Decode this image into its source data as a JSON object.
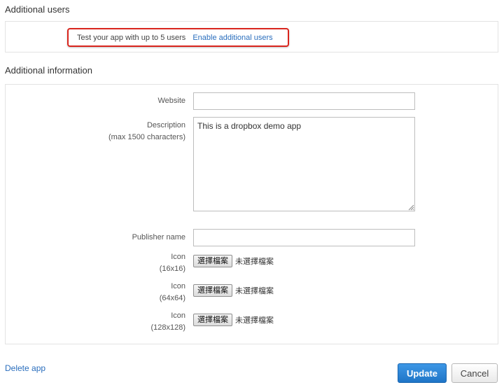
{
  "additional_users": {
    "title": "Additional users",
    "message": "Test your app with up to 5 users",
    "link": "Enable additional users"
  },
  "additional_information": {
    "title": "Additional information",
    "website": {
      "label": "Website",
      "value": ""
    },
    "description": {
      "label": "Description",
      "sublabel": "(max 1500 characters)",
      "value": "This is a dropbox demo app"
    },
    "publisher": {
      "label": "Publisher name",
      "value": ""
    },
    "icons": [
      {
        "label": "Icon",
        "size": "(16x16)",
        "button": "選擇檔案",
        "status": "未選擇檔案"
      },
      {
        "label": "Icon",
        "size": "(64x64)",
        "button": "選擇檔案",
        "status": "未選擇檔案"
      },
      {
        "label": "Icon",
        "size": "(128x128)",
        "button": "選擇檔案",
        "status": "未選擇檔案"
      }
    ]
  },
  "footer": {
    "delete_label": "Delete app",
    "update_label": "Update",
    "cancel_label": "Cancel"
  }
}
